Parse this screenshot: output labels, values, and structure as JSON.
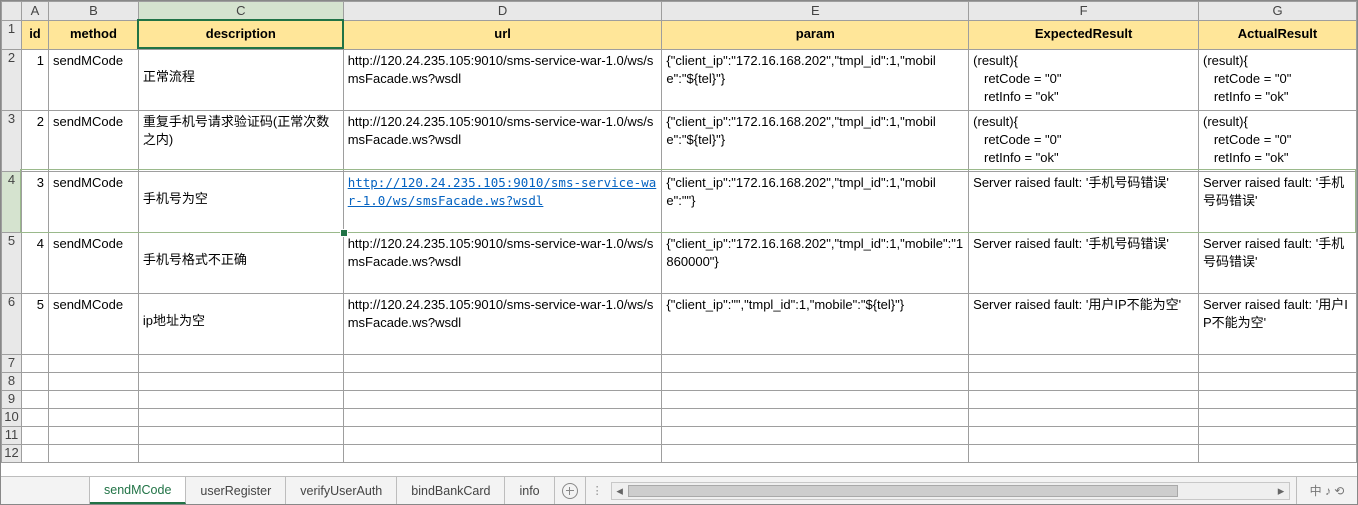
{
  "columns": [
    "A",
    "B",
    "C",
    "D",
    "E",
    "F",
    "G"
  ],
  "selectedColumn": "C",
  "selectedRow": 4,
  "rowNumbers": [
    1,
    2,
    3,
    4,
    5,
    6,
    7,
    8,
    9,
    10,
    11,
    12
  ],
  "headers": {
    "A": "id",
    "B": "method",
    "C": "description",
    "D": "url",
    "E": "param",
    "F": "ExpectedResult",
    "G": "ActualResult"
  },
  "rows": [
    {
      "id": "1",
      "method": "sendMCode",
      "description": "正常流程",
      "url": "http://120.24.235.105:9010/sms-service-war-1.0/ws/smsFacade.ws?wsdl",
      "urlLink": false,
      "param": "{\"client_ip\":\"172.16.168.202\",\"tmpl_id\":1,\"mobile\":\"${tel}\"}",
      "expected": "(result){\n   retCode = \"0\"\n   retInfo = \"ok\"",
      "actual": "(result){\n   retCode = \"0\"\n   retInfo = \"ok\""
    },
    {
      "id": "2",
      "method": "sendMCode",
      "description": "重复手机号请求验证码(正常次数之内)",
      "url": "http://120.24.235.105:9010/sms-service-war-1.0/ws/smsFacade.ws?wsdl",
      "urlLink": false,
      "param": "{\"client_ip\":\"172.16.168.202\",\"tmpl_id\":1,\"mobile\":\"${tel}\"}",
      "expected": "(result){\n   retCode = \"0\"\n   retInfo = \"ok\"",
      "actual": "(result){\n   retCode = \"0\"\n   retInfo = \"ok\""
    },
    {
      "id": "3",
      "method": "sendMCode",
      "description": "手机号为空",
      "url": "http://120.24.235.105:9010/sms-service-war-1.0/ws/smsFacade.ws?wsdl",
      "urlLink": true,
      "param": "{\"client_ip\":\"172.16.168.202\",\"tmpl_id\":1,\"mobile\":\"\"}",
      "expected": "Server raised fault: '手机号码错误'",
      "actual": "Server raised fault: '手机号码错误'"
    },
    {
      "id": "4",
      "method": "sendMCode",
      "description": "手机号格式不正确",
      "url": "http://120.24.235.105:9010/sms-service-war-1.0/ws/smsFacade.ws?wsdl",
      "urlLink": false,
      "param": "{\"client_ip\":\"172.16.168.202\",\"tmpl_id\":1,\"mobile\":\"1860000\"}",
      "expected": "Server raised fault: '手机号码错误'",
      "actual": "Server raised fault: '手机号码错误'"
    },
    {
      "id": "5",
      "method": "sendMCode",
      "description": "ip地址为空",
      "url": "http://120.24.235.105:9010/sms-service-war-1.0/ws/smsFacade.ws?wsdl",
      "urlLink": false,
      "param": "{\"client_ip\":\"\",\"tmpl_id\":1,\"mobile\":\"${tel}\"}",
      "expected": "Server raised fault: '用户IP不能为空'",
      "actual": "Server raised fault: '用户IP不能为空'"
    }
  ],
  "sheetTabs": [
    {
      "name": "sendMCode",
      "active": true
    },
    {
      "name": "userRegister",
      "active": false
    },
    {
      "name": "verifyUserAuth",
      "active": false
    },
    {
      "name": "bindBankCard",
      "active": false
    },
    {
      "name": "info",
      "active": false
    }
  ],
  "statusIcons": "中 ♪ ⟲"
}
